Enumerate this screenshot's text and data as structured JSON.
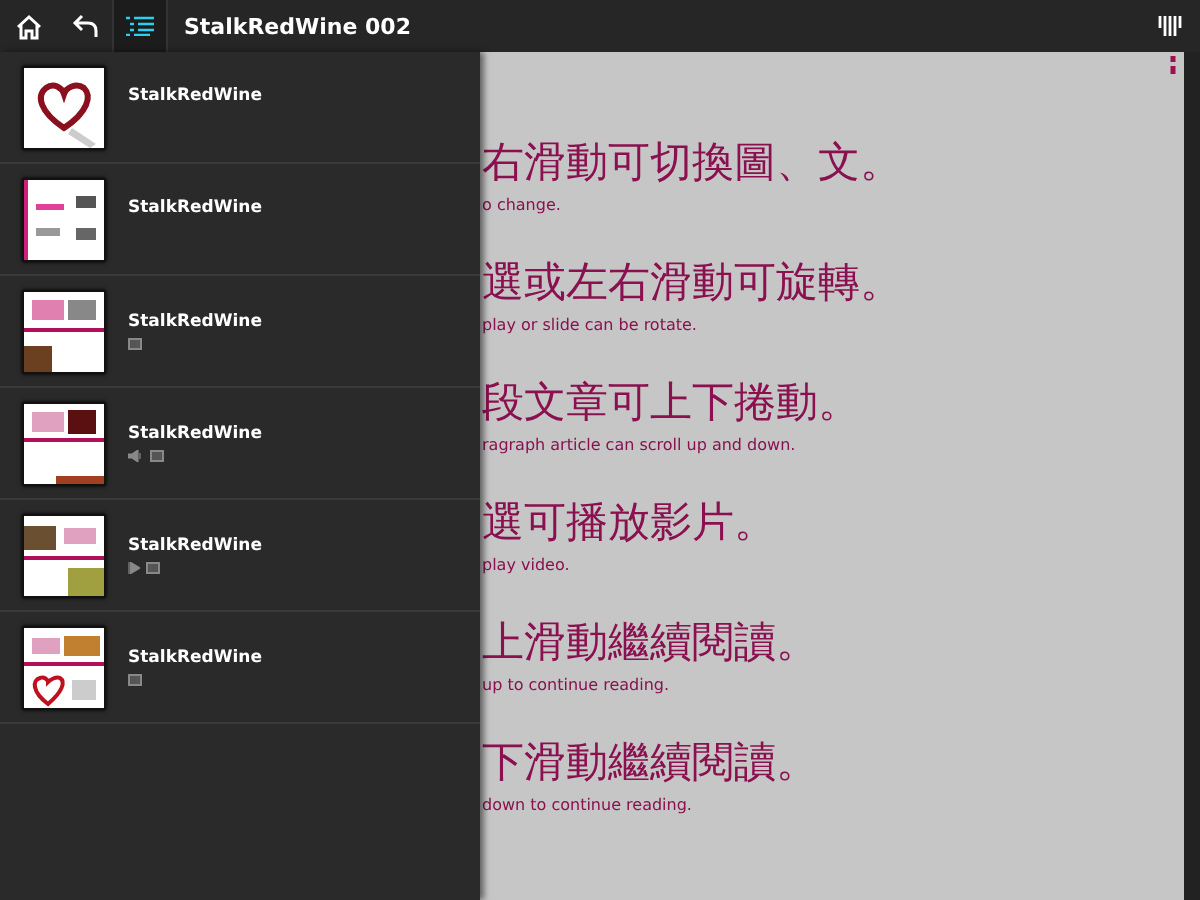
{
  "toolbar": {
    "buttons": [
      {
        "kind": "home",
        "selected": false
      },
      {
        "kind": "back",
        "selected": false
      },
      {
        "kind": "list",
        "selected": true
      }
    ],
    "title": "StalkRedWine 002"
  },
  "guide": [
    {
      "text": "右滑動可切換圖、文。",
      "caption": "o change."
    },
    {
      "text": "選或左右滑動可旋轉。",
      "caption": "play or slide can be rotate."
    },
    {
      "text": "段文章可上下捲動。",
      "caption": "ragraph article can scroll up and down."
    },
    {
      "text": "選可播放影片。",
      "caption": "play video."
    },
    {
      "text": "上滑動繼續閱讀。",
      "caption": "up to continue reading."
    },
    {
      "text": "下滑動繼續閱讀。",
      "caption": "down to continue reading."
    }
  ],
  "drawer": {
    "items": [
      {
        "title": "StalkRedWine"
      },
      {
        "title": "StalkRedWine"
      },
      {
        "title": "StalkRedWine",
        "badges": [
          {
            "kind": "box"
          }
        ]
      },
      {
        "title": "StalkRedWine",
        "badges": [
          {
            "kind": "sound"
          },
          {
            "kind": "box"
          }
        ]
      },
      {
        "title": "StalkRedWine",
        "badges": [
          {
            "kind": "play"
          },
          {
            "kind": "box"
          }
        ]
      },
      {
        "title": "StalkRedWine",
        "badges": [
          {
            "kind": "box"
          }
        ]
      }
    ]
  }
}
